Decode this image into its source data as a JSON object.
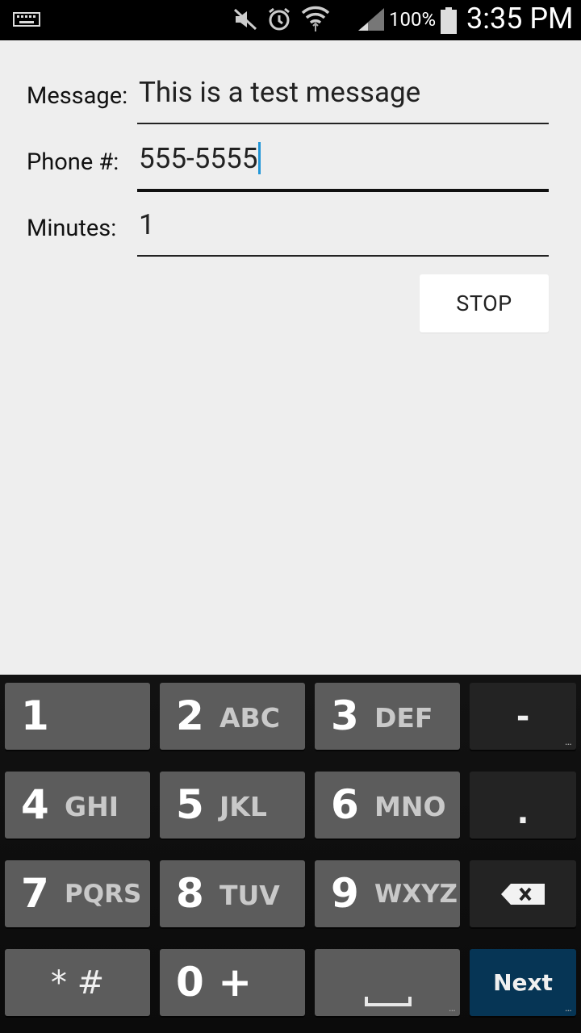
{
  "status_bar": {
    "battery_percent": "100%",
    "time": "3:35 PM",
    "icons": [
      "keyboard-icon",
      "mute-icon",
      "alarm-icon",
      "wifi-icon",
      "signal-icon",
      "battery-icon"
    ]
  },
  "form": {
    "message_label": "Message:",
    "message_value": "This is a test message",
    "phone_label": "Phone #:",
    "phone_value": "555-5555",
    "minutes_label": "Minutes:",
    "minutes_value": "1",
    "stop_label": "STOP"
  },
  "keyboard": {
    "keys": [
      {
        "num": "1",
        "letters": ""
      },
      {
        "num": "2",
        "letters": "ABC"
      },
      {
        "num": "3",
        "letters": "DEF"
      },
      {
        "num": "4",
        "letters": "GHI"
      },
      {
        "num": "5",
        "letters": "JKL"
      },
      {
        "num": "6",
        "letters": "MNO"
      },
      {
        "num": "7",
        "letters": "PQRS"
      },
      {
        "num": "8",
        "letters": "TUV"
      },
      {
        "num": "9",
        "letters": "WXYZ"
      }
    ],
    "dash": "-",
    "period": ".",
    "star_hash": "* #",
    "zero_plus": "0 +",
    "next_label": "Next",
    "more_dots": "..."
  },
  "colors": {
    "background": "#eeeeee",
    "keyboard_bg": "#121212",
    "key_gray": "#5c5c5c",
    "key_dark": "#232323",
    "next_key": "#063555",
    "cursor": "#2196d8"
  }
}
